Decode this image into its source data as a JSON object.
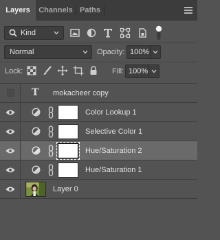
{
  "tabs": [
    {
      "label": "Layers",
      "active": true
    },
    {
      "label": "Channels",
      "active": false
    },
    {
      "label": "Paths",
      "active": false
    }
  ],
  "filter": {
    "kind_label": "Kind",
    "icons": [
      "image-filter-icon",
      "adjustment-filter-icon",
      "type-filter-icon",
      "shape-filter-icon",
      "smart-object-filter-icon"
    ]
  },
  "blend": {
    "mode": "Normal",
    "opacity_label": "Opacity:",
    "opacity_value": "100%",
    "fill_label": "Fill:",
    "fill_value": "100%"
  },
  "lock": {
    "label": "Lock:",
    "icons": [
      "lock-transparent-pixels-icon",
      "lock-image-pixels-icon",
      "lock-position-icon",
      "lock-artboard-icon",
      "lock-all-icon"
    ]
  },
  "layers": [
    {
      "name": "mokacheer copy",
      "type": "text",
      "visible": false,
      "selected": false
    },
    {
      "name": "Color Lookup 1",
      "type": "adjustment",
      "visible": true,
      "selected": false
    },
    {
      "name": "Selective Color 1",
      "type": "adjustment",
      "visible": true,
      "selected": false
    },
    {
      "name": "Hue/Saturation 2",
      "type": "adjustment",
      "visible": true,
      "selected": true
    },
    {
      "name": "Hue/Saturation 1",
      "type": "adjustment",
      "visible": true,
      "selected": false
    },
    {
      "name": "Layer 0",
      "type": "image",
      "visible": true,
      "selected": false
    }
  ],
  "colors": {
    "panel_bg": "#535353",
    "tab_bar_bg": "#3c3c3c",
    "selected_row": "#6a6a6a",
    "text": "#e2e2e2"
  }
}
